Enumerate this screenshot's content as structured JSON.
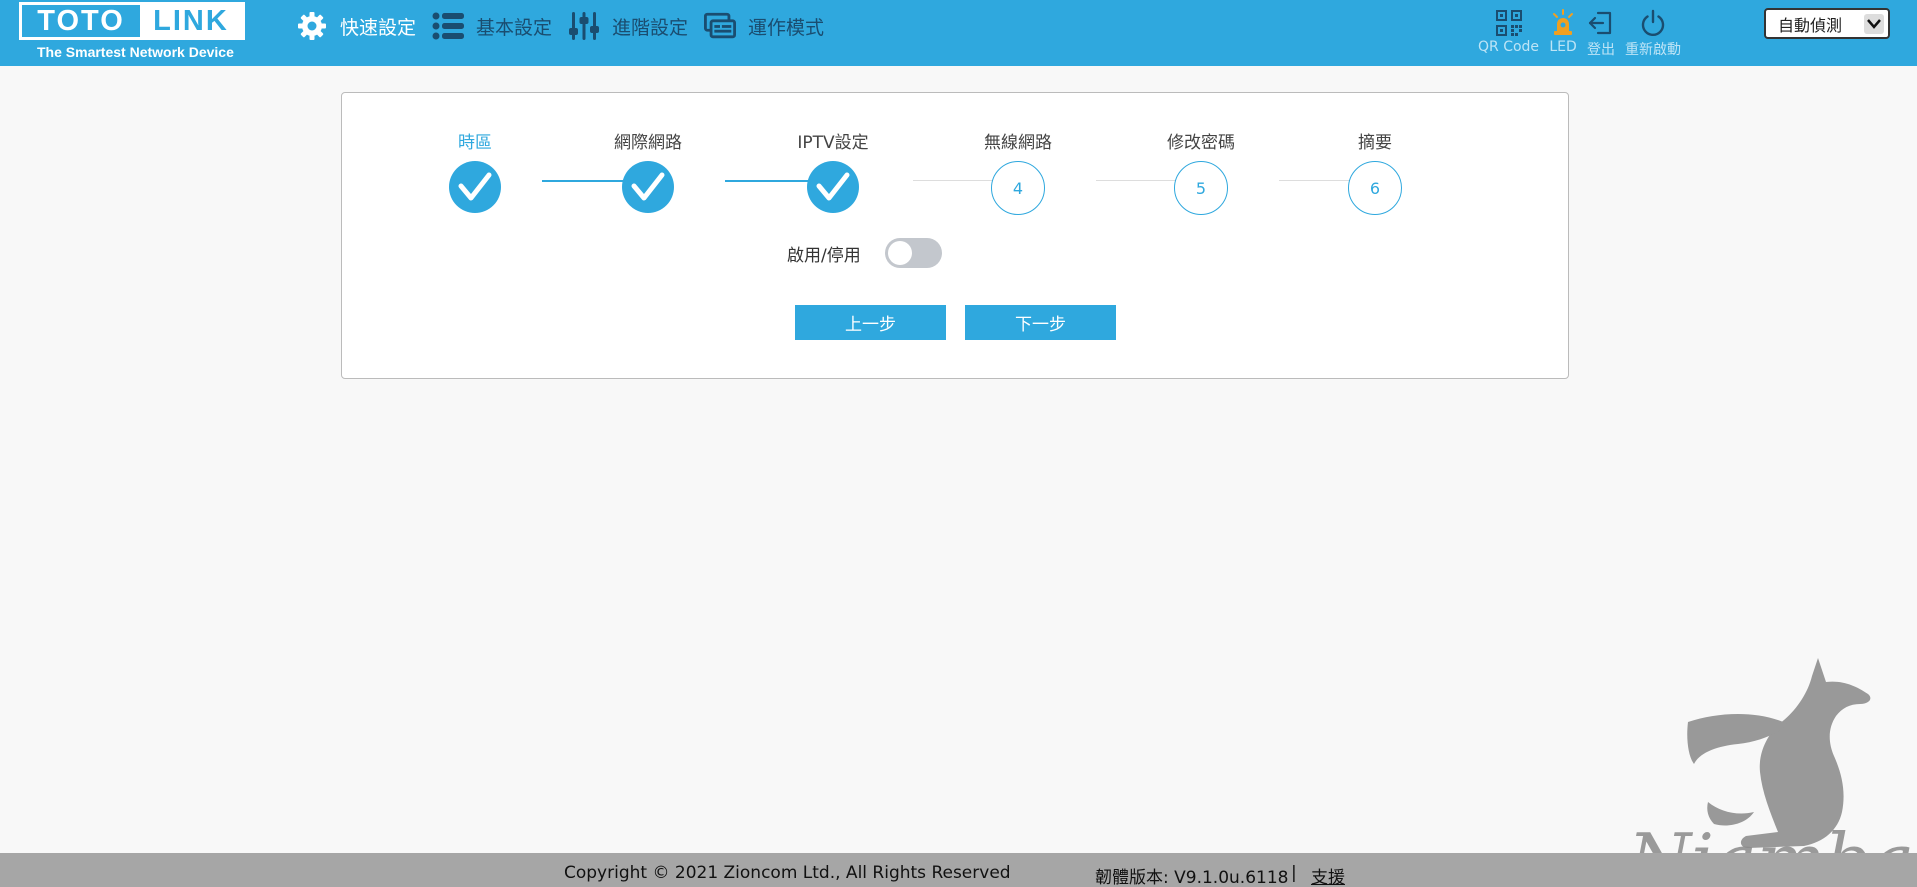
{
  "header": {
    "logo": {
      "left": "TOTO",
      "right": "LINK",
      "tagline": "The Smartest Network Device"
    },
    "nav": [
      {
        "label": "快速設定",
        "icon": "gear-icon",
        "active": true
      },
      {
        "label": "基本設定",
        "icon": "list-icon",
        "active": false
      },
      {
        "label": "進階設定",
        "icon": "sliders-icon",
        "active": false
      },
      {
        "label": "運作模式",
        "icon": "router-mode-icon",
        "active": false
      }
    ],
    "tools": [
      {
        "label": "QR Code",
        "icon": "qr-code-icon"
      },
      {
        "label": "LED",
        "icon": "led-icon"
      },
      {
        "label": "登出",
        "icon": "logout-icon"
      },
      {
        "label": "重新啟動",
        "icon": "power-icon"
      }
    ],
    "language": {
      "selected": "自動偵測"
    }
  },
  "wizard": {
    "steps": [
      {
        "name": "時區",
        "status": "done",
        "current": true
      },
      {
        "name": "網際網路",
        "status": "done"
      },
      {
        "name": "IPTV設定",
        "status": "done"
      },
      {
        "name": "無線網路",
        "status": "todo",
        "number": "4"
      },
      {
        "name": "修改密碼",
        "status": "todo",
        "number": "5"
      },
      {
        "name": "摘要",
        "status": "todo",
        "number": "6"
      }
    ],
    "toggle_label": "啟用/停用",
    "toggle_on": false,
    "prev_label": "上一步",
    "next_label": "下一步"
  },
  "footer": {
    "copyright": "Copyright © 2021 Zioncom Ltd., All Rights Reserved",
    "firmware": "韌體版本: V9.1.0u.6118",
    "separator": "|",
    "help": "支援"
  },
  "watermark": {
    "text": "Niambao"
  },
  "colors": {
    "primary": "#2fa8de",
    "nav_inactive": "#1a4d70",
    "led": "#f0a020",
    "footer": "#a6a6a6"
  }
}
